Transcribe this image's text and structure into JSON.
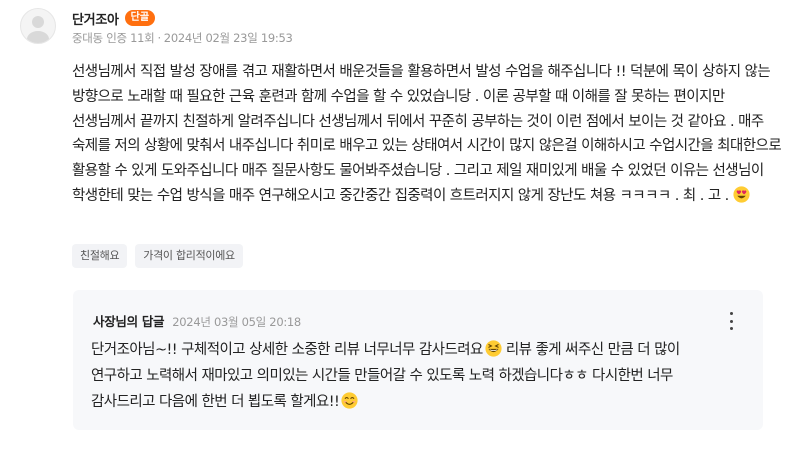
{
  "review": {
    "author": "단거조아",
    "badge": "단골",
    "meta": {
      "location": "중대동 인증 11회",
      "separator": "·",
      "date": "2024년 02월 23일 19:53"
    },
    "body": "선생님께서 직접 발성 장애를 겪고 재활하면서 배운것들을 활용하면서 발성 수업을 해주십니다 !! 덕분에 목이 상하지 않는 방향으로 노래할 때 필요한 근육 훈련과 함께 수업을 할 수 있었습니당 . 이론 공부할 때 이해를 잘 못하는 편이지만 선생님께서 끝까지 친절하게 알려주십니다 선생님께서 뒤에서 꾸준히 공부하는 것이 이런 점에서 보이는 것 같아요 . 매주 숙제를 저의 상황에 맞춰서 내주십니다 취미로 배우고 있는 상태여서 시간이 많지 않은걸 이해하시고 수업시간을 최대한으로 활용할 수 있게 도와주십니다 매주 질문사항도 물어봐주셨습니당 . 그리고 제일 재미있게 배울 수 있었던 이유는 선생님이 학생한테 맞는 수업 방식을 매주 연구해오시고 중간중간 집중력이 흐트러지지 않게 장난도 쳐용 ㅋㅋㅋㅋ . 최 . 고 .",
    "emoji": "heart-eyes-emoji",
    "tags": [
      "친절해요",
      "가격이 합리적이에요"
    ]
  },
  "reply": {
    "title": "사장님의 답글",
    "date": "2024년 03월 05일 20:18",
    "body_part1": "단거조아님~!! 구체적이고 상세한 소중한 리뷰 너무너무 감사드려요",
    "body_part2": " 리뷰 좋게 써주신 만큼 더 많이 연구하고 노력해서 재마있고 의미있는 시간들 만들어갈 수 있도록 노력 하겠습니다ㅎㅎ 다시한번 너무 감사드리고 다음에 한번 더 뵙도록 할게요!!",
    "emoji_1": "grinning-squinting-emoji",
    "emoji_2": "smiling-emoji",
    "menu_icon": "more-vertical-icon"
  },
  "colors": {
    "badge": "#ff6f0f",
    "reply_background": "#f7f8fa",
    "tag_background": "#f2f3f6",
    "muted_text": "#999999"
  }
}
